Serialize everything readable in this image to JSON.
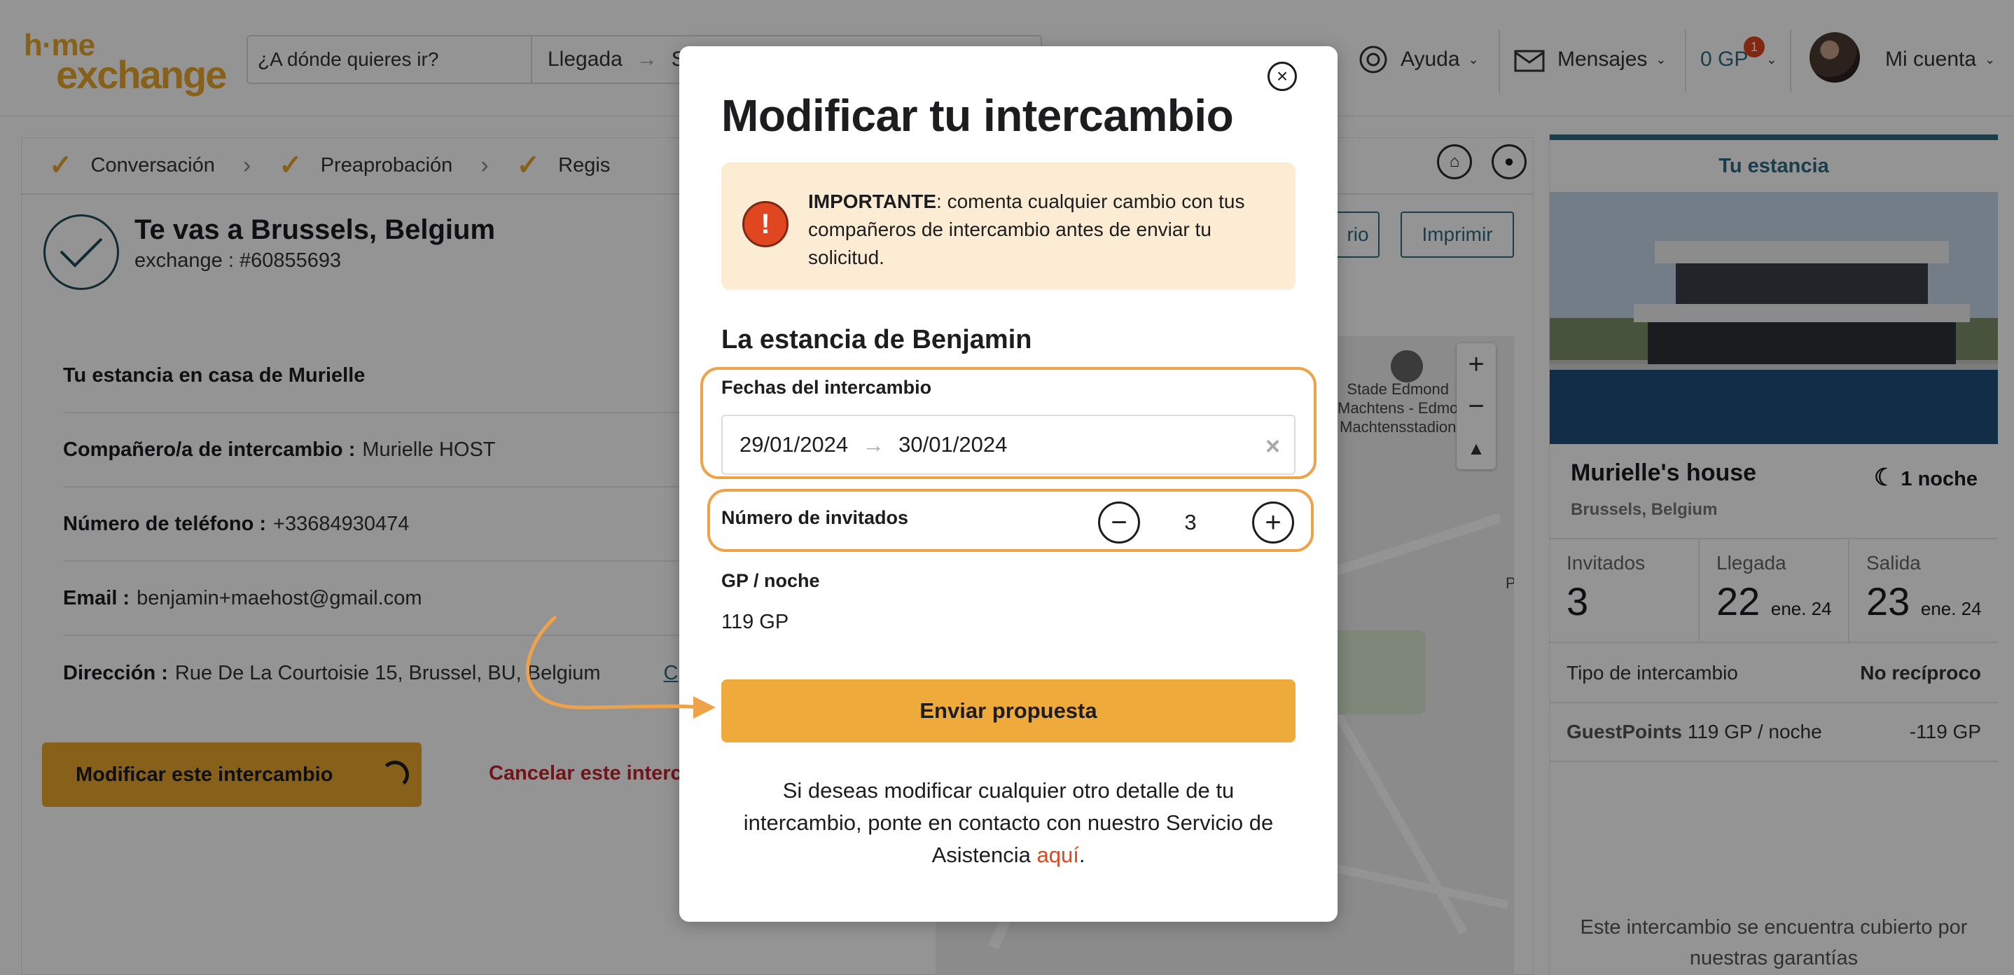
{
  "header": {
    "logo_line1": "h·me",
    "logo_line2": "exchange",
    "search_placeholder": "¿A dónde quieres ir?",
    "search_dates_label": "Llegada",
    "search_dates_arrow": "→",
    "search_dates_partial": "S",
    "help_label": "Ayuda",
    "messages_label": "Mensajes",
    "gp_label": "0 GP",
    "gp_badge": "1",
    "account_label": "Mi cuenta"
  },
  "steps": [
    {
      "label": "Conversación"
    },
    {
      "label": "Preaprobación"
    },
    {
      "label": "Regis"
    }
  ],
  "exchange": {
    "title": "Te vas a Brussels, Belgium",
    "subtitle": "exchange : #60855693",
    "btn_partial": "rio",
    "print_label": "Imprimir",
    "stay_label": "Tu estancia en casa de Murielle",
    "partner_label": "Compañero/a de intercambio :",
    "partner_value": "Murielle HOST",
    "phone_label": "Número de teléfono :",
    "phone_value": "+33684930474",
    "email_label": "Email :",
    "email_value": "benjamin+maehost@gmail.com",
    "address_label": "Dirección :",
    "address_value": "Rue De La Courtoisie 15, Brussel, BU, Belgium",
    "address_link_partial": "C",
    "modify_btn": "Modificar este intercambio",
    "cancel_link": "Cancelar este interc"
  },
  "map": {
    "stadium_label": "Stade Edmond\nMachtens - Edmo\nMachtensstadion",
    "zoom_in": "+",
    "zoom_out": "−",
    "edge_label": "P"
  },
  "sidebar": {
    "tab": "Tu estancia",
    "house_title": "Murielle's house",
    "nights": "1 noche",
    "location": "Brussels, Belgium",
    "guests_label": "Invitados",
    "guests_value": "3",
    "arrival_label": "Llegada",
    "arrival_day": "22",
    "arrival_month": "ene. 24",
    "departure_label": "Salida",
    "departure_day": "23",
    "departure_month": "ene. 24",
    "exchange_type_label": "Tipo de intercambio",
    "exchange_type_value": "No recíproco",
    "gp_label": "GuestPoints",
    "gp_rate": "119 GP / noche",
    "gp_total": "-119 GP",
    "guarantee": "Este intercambio se encuentra cubierto por nuestras garantías"
  },
  "modal": {
    "title": "Modificar tu intercambio",
    "alert_bold": "IMPORTANTE",
    "alert_text": ": comenta cualquier cambio con tus compañeros de intercambio antes de enviar tu solicitud.",
    "stay_title": "La estancia de Benjamin",
    "dates_label": "Fechas del intercambio",
    "date_start": "29/01/2024",
    "date_arrow": "→",
    "date_end": "30/01/2024",
    "guests_label": "Número de invitados",
    "guests_value": "3",
    "gp_label": "GP / noche",
    "gp_value": "119 GP",
    "submit_label": "Enviar propuesta",
    "footer_text": "Si deseas modificar cualquier otro detalle de tu intercambio, ponte en contacto con nuestro Servicio de Asistencia ",
    "footer_link": "aquí",
    "footer_end": "."
  },
  "colors": {
    "accent": "#eeab3b",
    "brand_teal": "#2b6b7e",
    "alert_bg": "#fcecd3",
    "alert_icon": "#e0461f",
    "highlight": "#eea34a",
    "link": "#e0461f"
  }
}
